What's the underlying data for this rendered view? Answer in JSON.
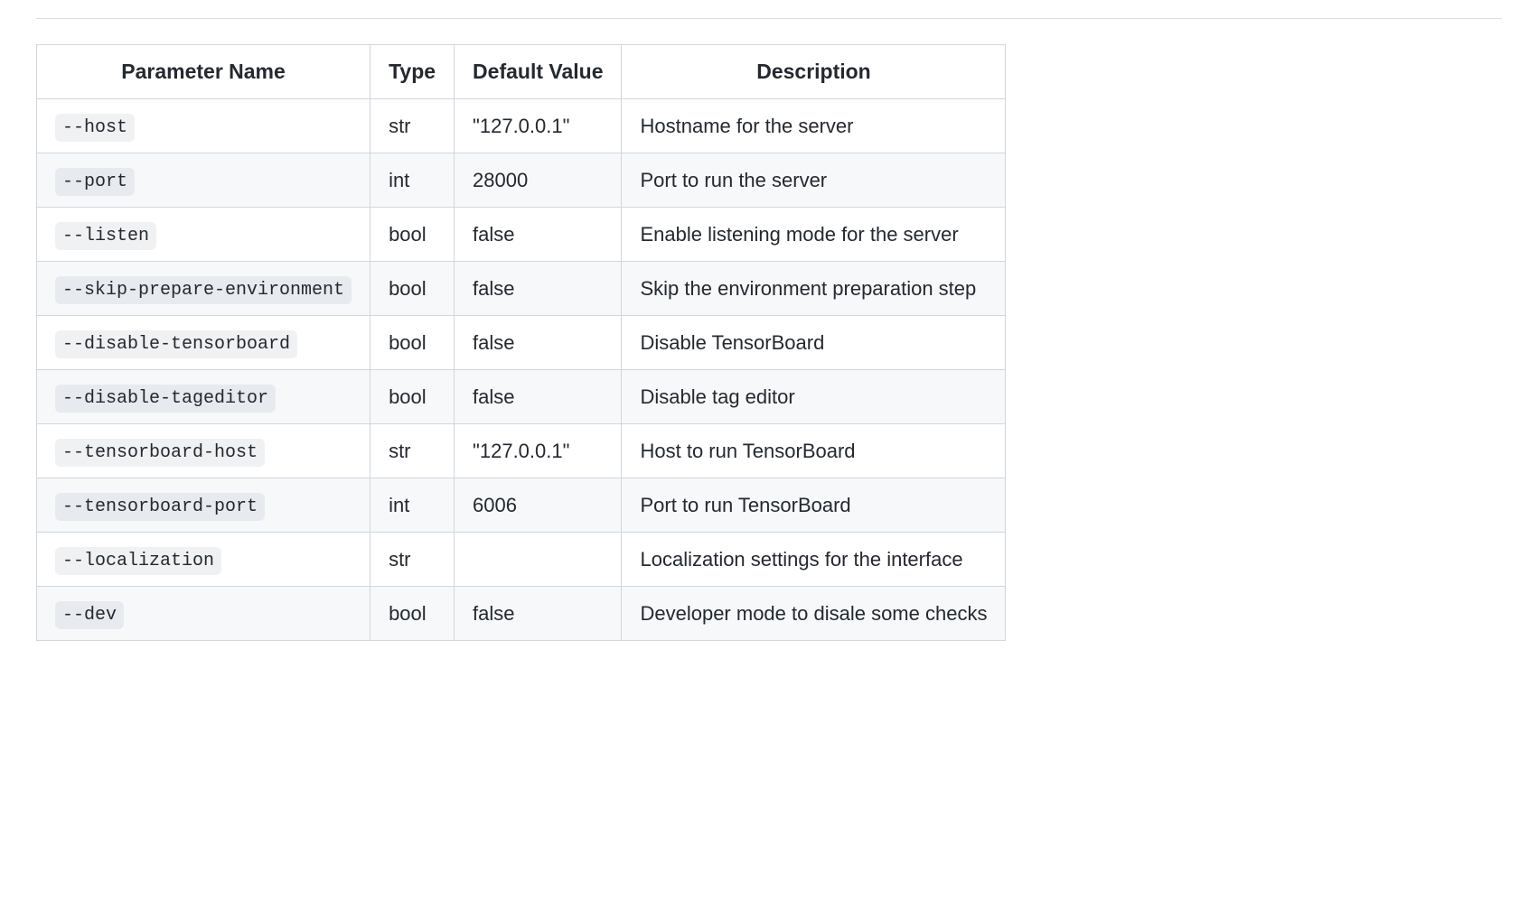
{
  "table": {
    "headers": {
      "parameter": "Parameter Name",
      "type": "Type",
      "default": "Default Value",
      "description": "Description"
    },
    "rows": [
      {
        "param": "--host",
        "type": "str",
        "default": "\"127.0.0.1\"",
        "description": "Hostname for the server"
      },
      {
        "param": "--port",
        "type": "int",
        "default": "28000",
        "description": "Port to run the server"
      },
      {
        "param": "--listen",
        "type": "bool",
        "default": "false",
        "description": "Enable listening mode for the server"
      },
      {
        "param": "--skip-prepare-environment",
        "type": "bool",
        "default": "false",
        "description": "Skip the environment preparation step"
      },
      {
        "param": "--disable-tensorboard",
        "type": "bool",
        "default": "false",
        "description": "Disable TensorBoard"
      },
      {
        "param": "--disable-tageditor",
        "type": "bool",
        "default": "false",
        "description": "Disable tag editor"
      },
      {
        "param": "--tensorboard-host",
        "type": "str",
        "default": "\"127.0.0.1\"",
        "description": "Host to run TensorBoard"
      },
      {
        "param": "--tensorboard-port",
        "type": "int",
        "default": "6006",
        "description": "Port to run TensorBoard"
      },
      {
        "param": "--localization",
        "type": "str",
        "default": "",
        "description": "Localization settings for the interface"
      },
      {
        "param": "--dev",
        "type": "bool",
        "default": "false",
        "description": "Developer mode to disale some checks"
      }
    ]
  }
}
